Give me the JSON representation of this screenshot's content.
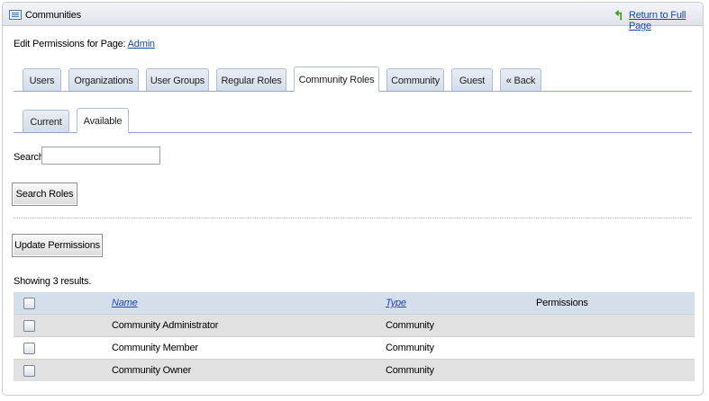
{
  "portlet": {
    "title": "Communities",
    "return_link": "Return to Full Page"
  },
  "edit": {
    "prefix": "Edit Permissions for Page:",
    "page_link": "Admin"
  },
  "main_tabs": [
    {
      "label": "Users"
    },
    {
      "label": "Organizations"
    },
    {
      "label": "User Groups"
    },
    {
      "label": "Regular Roles"
    },
    {
      "label": "Community Roles",
      "selected": true
    },
    {
      "label": "Community"
    },
    {
      "label": "Guest"
    },
    {
      "label": "« Back"
    }
  ],
  "sub_tabs": [
    {
      "label": "Current"
    },
    {
      "label": "Available",
      "selected": true
    }
  ],
  "search": {
    "label": "Search",
    "value": "",
    "button": "Search Roles"
  },
  "update_button": "Update Permissions",
  "showing": "Showing 3 results.",
  "table": {
    "headers": {
      "name": "Name",
      "type": "Type",
      "permissions": "Permissions"
    },
    "rows": [
      {
        "name": "Community Administrator",
        "type": "Community",
        "permissions": ""
      },
      {
        "name": "Community Member",
        "type": "Community",
        "permissions": ""
      },
      {
        "name": "Community Owner",
        "type": "Community",
        "permissions": ""
      }
    ]
  },
  "colors": {
    "link": "#1a48a8",
    "header_row": "#d5dfec",
    "alt_row": "#e1e1e1",
    "tab_border": "#8fa8c8"
  }
}
